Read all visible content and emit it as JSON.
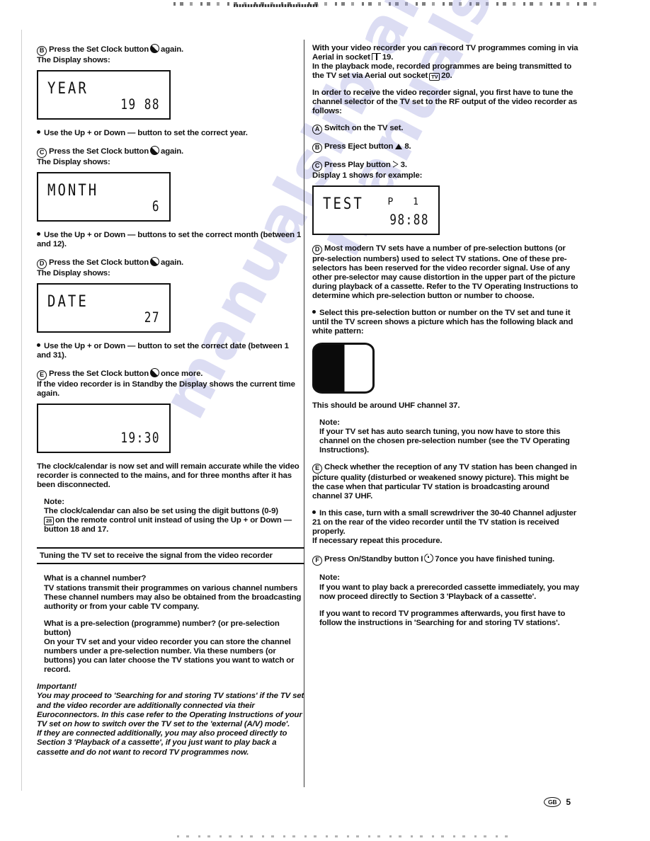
{
  "page": {
    "number": "5",
    "region_badge": "GB"
  },
  "left_column": {
    "step_b": {
      "letter": "B",
      "line1_pre": "Press the Set Clock button",
      "line1_post": "again.",
      "line2": "The Display shows:"
    },
    "display_year": {
      "word": "YEAR",
      "value": "19 88"
    },
    "bullet_year": "Use the Up + or Down — button to set the correct year.",
    "step_c": {
      "letter": "C",
      "line1_pre": "Press the Set Clock button",
      "line1_post": "again.",
      "line2": "The Display shows:"
    },
    "display_month": {
      "word": "MONTH",
      "value": "6"
    },
    "bullet_month": "Use the Up + or Down — buttons to set the correct month (between 1 and 12).",
    "step_d": {
      "letter": "D",
      "line1_pre": "Press the Set Clock button",
      "line1_post": "again.",
      "line2": "The Display shows:"
    },
    "display_date": {
      "word": "DATE",
      "value": "27"
    },
    "bullet_date": "Use the Up + or Down — button to set the correct date (between 1 and 31).",
    "step_e": {
      "letter": "E",
      "line1_pre": "Press the Set Clock button",
      "line1_post": "once more.",
      "line2": "If the video recorder is in Standby the Display shows the current time again."
    },
    "display_time": {
      "value": "19:30"
    },
    "clock_accuracy": "The clock/calendar is now set and will remain accurate while the video recorder is connected to the mains, and for three months after it has been disconnected.",
    "note1": {
      "title": "Note:",
      "line1": "The clock/calendar can also be set using the digit buttons (0-9)",
      "remote_button": "28",
      "line2_pre": "on the remote control unit instead of using the Up + or Down — button",
      "button_a": "18",
      "and": "and",
      "button_b": "17",
      "period": "."
    },
    "section_heading": "Tuning the TV set to receive the signal from the video recorder",
    "channel_number": {
      "title": "What is a channel number?",
      "body": "TV stations transmit their programmes on various channel numbers  These channel numbers may also be obtained from the broadcasting authority or from your cable TV company."
    },
    "pre_selection": {
      "title_bold": "What is a pre-selection (programme) number?",
      "title_rest": "(or pre-selection button)",
      "body": "On your TV set and your video recorder you can store the channel numbers under a pre-selection number. Via these numbers (or buttons) you can later choose the TV stations you want to watch or record."
    },
    "important": {
      "title": "Important!",
      "para1": "You may proceed to 'Searching for and storing TV stations' if the TV set and the video recorder are additionally connected via their Euroconnectors. In this case refer to the Operating Instructions of your TV set on how to switch over the TV set to the 'external (A/V) mode'.",
      "para2": "If they are connected additionally, you may also proceed directly to Section 3 'Playback of a cassette', if you just want to play back a cassette and do not want to record TV programmes now."
    }
  },
  "right_column": {
    "intro": {
      "line1_pre": "With your video recorder you can record TV programmes coming in via Aerial in socket",
      "socket_in_number": "19",
      "line1_post": ".",
      "line2_pre": "In the playback mode, recorded programmes are being transmitted to the TV set via Aerial out socket",
      "tv_icon_label": "TV",
      "socket_out_number": "20",
      "line2_post": "."
    },
    "tune_intro": "In order to receive the video recorder signal, you first have to tune the channel selector of the TV set to the RF output of the video recorder as follows:",
    "step_a": {
      "letter": "A",
      "text": "Switch on the TV set."
    },
    "step_b": {
      "letter": "B",
      "text_pre": "Press Eject button",
      "number": "8",
      "text_post": "."
    },
    "step_c": {
      "letter": "C",
      "text_pre": "Press Play button",
      "number": "3",
      "text_post": ".",
      "line2_pre": "Display",
      "line2_bold": "1",
      "line2_post": "shows for example:"
    },
    "display_test": {
      "word": "TEST",
      "preselect": "P  1",
      "value": "98:88"
    },
    "step_d": {
      "letter": "D",
      "text": "Most modern TV sets have a number of pre-selection buttons (or pre-selection numbers) used to select TV stations. One of these pre-selectors has been reserved for the video recorder signal. Use of any other pre-selector may cause distortion in the upper part of the picture during playback of a cassette. Refer to the TV Operating Instructions to determine which pre-selection button or number to choose."
    },
    "bullet_select": "Select this pre-selection button or number on the TV set and tune it until the TV screen shows a picture which has the following black and white pattern:",
    "uhf_caption": "This should be around UHF channel 37.",
    "note1": {
      "title": "Note:",
      "body": "If your TV set has auto search tuning, you now have to store this channel on the chosen pre-selection number (see the TV Operating Instructions)."
    },
    "step_e": {
      "letter": "E",
      "text": "Check whether the reception of any TV station has been changed in picture quality (disturbed or weakened snowy picture). This might be the case when that particular TV station is broadcasting around channel 37 UHF."
    },
    "bullet_screwdriver": {
      "text_pre": "In this case, turn with a small screwdriver the 30-40 Channel adjuster",
      "number": "21",
      "text_post": "on the rear of the video recorder until the TV station is received properly.",
      "line2": "If necessary repeat this procedure."
    },
    "step_f": {
      "letter": "F",
      "text_pre": "Press On/Standby button I",
      "number": "7",
      "text_post": "once you have finished tuning."
    },
    "note2": {
      "title": "Note:",
      "para1": "If you want to play back a prerecorded cassette immediately, you may now proceed directly to Section 3 'Playback of a cassette'.",
      "para2": "If you want to record TV programmes afterwards, you first have to follow the instructions in 'Searching for and storing TV stations'."
    }
  },
  "watermark": {
    "text": "manualslib archive",
    "color": "#8f90d8"
  }
}
